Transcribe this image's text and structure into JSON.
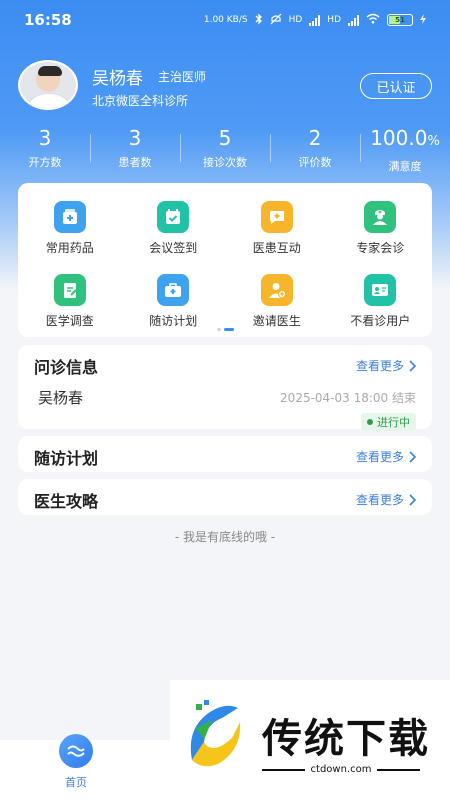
{
  "status_bar": {
    "time": "16:58",
    "net_speed": "1.00 KB/S",
    "signal_1": "HD",
    "signal_2": "HD",
    "battery": "51"
  },
  "profile": {
    "name": "吴杨春",
    "title": "主治医师",
    "clinic": "北京微医全科诊所",
    "verified_label": "已认证"
  },
  "stats": [
    {
      "value": "3",
      "label": "开方数"
    },
    {
      "value": "3",
      "label": "患者数"
    },
    {
      "value": "5",
      "label": "接诊次数"
    },
    {
      "value": "2",
      "label": "评价数"
    },
    {
      "value": "100.0",
      "unit": "%",
      "label": "满意度"
    }
  ],
  "grid": {
    "items": [
      {
        "label": "常用药品",
        "icon": "medicine-box-icon",
        "color": "#3fa2ee"
      },
      {
        "label": "会议签到",
        "icon": "calendar-check-icon",
        "color": "#21c2a6"
      },
      {
        "label": "医患互动",
        "icon": "chat-plus-icon",
        "color": "#f7b52c"
      },
      {
        "label": "专家会诊",
        "icon": "nurse-icon",
        "color": "#2fc27e"
      },
      {
        "label": "医学调查",
        "icon": "clipboard-edit-icon",
        "color": "#2fc27e"
      },
      {
        "label": "随访计划",
        "icon": "first-aid-kit-icon",
        "color": "#3fa2ee"
      },
      {
        "label": "邀请医生",
        "icon": "invite-user-icon",
        "color": "#f7b52c"
      },
      {
        "label": "不看诊用户",
        "icon": "user-card-icon",
        "color": "#21c2a6"
      }
    ]
  },
  "consult": {
    "title": "问诊信息",
    "more": "查看更多",
    "patient": "吴杨春",
    "time": "2025-04-03 18:00 结束",
    "status": "进行中"
  },
  "followup": {
    "title": "随访计划",
    "more": "查看更多"
  },
  "guide": {
    "title": "医生攻略",
    "more": "查看更多"
  },
  "footer_text": "- 我是有底线的哦 -",
  "tabbar": {
    "home_label": "首页"
  },
  "watermark": {
    "title": "传统下载",
    "url": "ctdown.com"
  },
  "colors": {
    "primary": "#3c8df2",
    "link": "#3c7fe0",
    "success": "#2e9a4a"
  }
}
